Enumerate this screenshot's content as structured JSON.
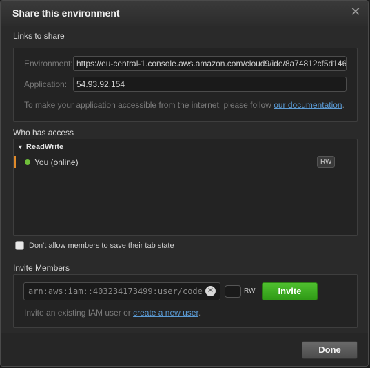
{
  "dialog": {
    "title": "Share this environment",
    "close_glyph": "✕"
  },
  "links": {
    "section_label": "Links to share",
    "environment_label": "Environment:",
    "environment_url": "https://eu-central-1.console.aws.amazon.com/cloud9/ide/8a74812cf5d146",
    "application_label": "Application:",
    "application_value": "54.93.92.154",
    "hint_prefix": "To make your application accessible from the internet, please follow ",
    "hint_link": "our documentation",
    "hint_suffix": "."
  },
  "access": {
    "section_label": "Who has access",
    "group_caret": "▼",
    "group_name": "ReadWrite",
    "members": [
      {
        "name": "You (online)",
        "permission": "RW",
        "online_color": "#6fbf3a"
      }
    ]
  },
  "tab_state": {
    "label": "Don't allow members to save their tab state",
    "checked": false
  },
  "invite": {
    "section_label": "Invite Members",
    "input_value": "arn:aws:iam::403234173499:user/code",
    "clear_glyph": "✕",
    "permission_label": "RW",
    "button_label": "Invite",
    "hint_prefix": "Invite an existing IAM user or ",
    "hint_link": "create a new user",
    "hint_suffix": ".",
    "button_color": "#3aad1f"
  },
  "footer": {
    "done_label": "Done"
  }
}
